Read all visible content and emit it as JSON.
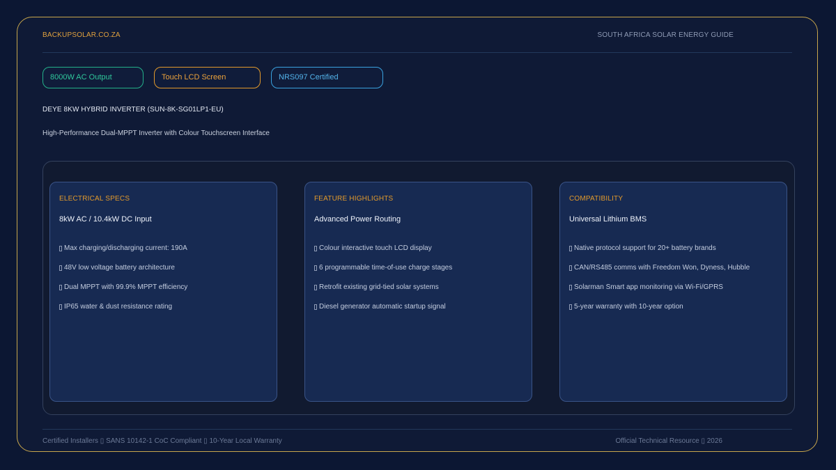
{
  "header": {
    "brand": "BACKUPSOLAR.CO.ZA",
    "guide": "SOUTH AFRICA SOLAR ENERGY GUIDE"
  },
  "badges": [
    {
      "label": "8000W AC Output",
      "color": "#2fc79b"
    },
    {
      "label": "Touch LCD Screen",
      "color": "#eba23c"
    },
    {
      "label": "NRS097 Certified",
      "color": "#53b3ea"
    }
  ],
  "product": {
    "title": "DEYE 8KW HYBRID INVERTER (SUN-8K-SG01LP1-EU)",
    "subtitle": "High-Performance Dual-MPPT Inverter with Colour Touchscreen Interface"
  },
  "cards": [
    {
      "kicker": "ELECTRICAL SPECS",
      "heading": "8kW AC / 10.4kW DC Input",
      "items": [
        "Max charging/discharging current: 190A",
        "48V low voltage battery architecture",
        "Dual MPPT with 99.9% MPPT efficiency",
        "IP65 water & dust resistance rating"
      ]
    },
    {
      "kicker": "FEATURE HIGHLIGHTS",
      "heading": "Advanced Power Routing",
      "items": [
        "Colour interactive touch LCD display",
        "6 programmable time-of-use charge stages",
        "Retrofit existing grid-tied solar systems",
        "Diesel generator automatic startup signal"
      ]
    },
    {
      "kicker": "COMPATIBILITY",
      "heading": "Universal Lithium BMS",
      "items": [
        "Native protocol support for 20+ battery brands",
        "CAN/RS485 comms with Freedom Won, Dyness, Hubble",
        "Solarman Smart app monitoring via Wi-Fi/GPRS",
        "5-year warranty with 10-year option"
      ]
    }
  ],
  "footer": {
    "left": "Certified Installers ▯ SANS 10142-1 CoC Compliant ▯ 10-Year Local Warranty",
    "right": "Official Technical Resource ▯ 2026"
  },
  "colors": {
    "background": "#0c1733",
    "frame_border": "#c9a74c",
    "accent": "#e39a2b"
  }
}
